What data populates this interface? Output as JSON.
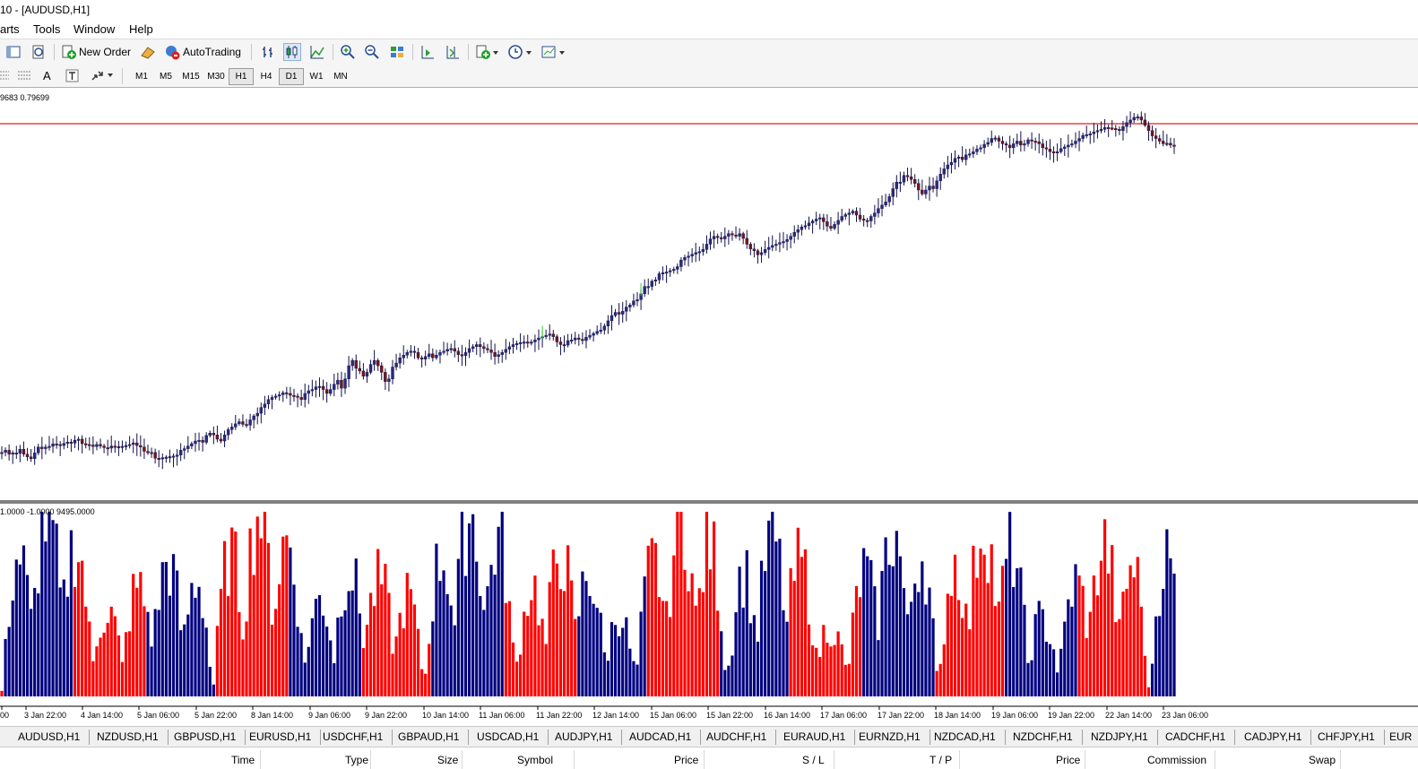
{
  "window": {
    "title": "10 - [AUDUSD,H1]"
  },
  "menu": [
    "arts",
    "Tools",
    "Window",
    "Help"
  ],
  "toolbar": {
    "new_order": "New Order",
    "auto_trading": "AutoTrading",
    "line_tool_label": "A"
  },
  "timeframes": [
    "M1",
    "M5",
    "M15",
    "M30",
    "H1",
    "H4",
    "D1",
    "W1",
    "MN"
  ],
  "active_timeframe": "H1",
  "main_pane": {
    "label": "9683 0.79699",
    "resistance_color": "#e01c1c",
    "up_color": "#2bd12b",
    "down_color": "#7a1414"
  },
  "indicator_pane": {
    "label": "1.0000 -1.0000 9495.0000",
    "bull_color": "#00007f",
    "bear_color": "#ff0000"
  },
  "time_axis": [
    "00",
    "3 Jan 22:00",
    "4 Jan 14:00",
    "5 Jan 06:00",
    "5 Jan 22:00",
    "8 Jan 14:00",
    "9 Jan 06:00",
    "9 Jan 22:00",
    "10 Jan 14:00",
    "11 Jan 06:00",
    "11 Jan 22:00",
    "12 Jan 14:00",
    "15 Jan 06:00",
    "15 Jan 22:00",
    "16 Jan 14:00",
    "17 Jan 06:00",
    "17 Jan 22:00",
    "18 Jan 14:00",
    "19 Jan 06:00",
    "19 Jan 22:00",
    "22 Jan 14:00",
    "23 Jan 06:00"
  ],
  "symbol_tabs": [
    "AUDUSD,H1",
    "NZDUSD,H1",
    "GBPUSD,H1",
    "EURUSD,H1",
    "USDCHF,H1",
    "GBPAUD,H1",
    "USDCAD,H1",
    "AUDJPY,H1",
    "AUDCAD,H1",
    "AUDCHF,H1",
    "EURAUD,H1",
    "EURNZD,H1",
    "NZDCAD,H1",
    "NZDCHF,H1",
    "NZDJPY,H1",
    "CADCHF,H1",
    "CADJPY,H1",
    "CHFJPY,H1",
    "EUR"
  ],
  "terminal_columns": [
    "Time",
    "Type",
    "Size",
    "Symbol",
    "Price",
    "S / L",
    "T / P",
    "Price",
    "Commission",
    "Swap"
  ],
  "chart_data": {
    "type": "candlestick",
    "title": "",
    "price_path": [
      62,
      70,
      55,
      60,
      58,
      74,
      55,
      45,
      38,
      60,
      82,
      76,
      82,
      85,
      94,
      92,
      88,
      96,
      101,
      97,
      108,
      112,
      95,
      92,
      90,
      84,
      92,
      86,
      80,
      78,
      86,
      84,
      83,
      85,
      88,
      92,
      98,
      88,
      82,
      66,
      60,
      62,
      40,
      38,
      42,
      44,
      46,
      48,
      52,
      70,
      76,
      86,
      95,
      105,
      108,
      100,
      126,
      135,
      128,
      112,
      105,
      128,
      148,
      158,
      170,
      178,
      168,
      165,
      185,
      200,
      210,
      232,
      245,
      262,
      270,
      275,
      280,
      288,
      285,
      278,
      275,
      270,
      262,
      285,
      295,
      300,
      310,
      312,
      300,
      285,
      300,
      320,
      335,
      305,
      340,
      390,
      410,
      380,
      370,
      350,
      365,
      395,
      410,
      390,
      365,
      330,
      340,
      385,
      400,
      420,
      430,
      440,
      445,
      440,
      420,
      415,
      425,
      435,
      420,
      430,
      440,
      445,
      452,
      455,
      445,
      432,
      428,
      440,
      455,
      462,
      470,
      462,
      455,
      450,
      440,
      425,
      432,
      440,
      452,
      462,
      470,
      474,
      478,
      480,
      478,
      480,
      488,
      495,
      500,
      505,
      510,
      500,
      480,
      470,
      468,
      485,
      488,
      495,
      490,
      485,
      498,
      505,
      512,
      520,
      525,
      540,
      560,
      580,
      592,
      585,
      596,
      612,
      620,
      635,
      640,
      662,
      690,
      690,
      710,
      715,
      738,
      742,
      745,
      750,
      755,
      765,
      790,
      800,
      805,
      812,
      818,
      822,
      830,
      850,
      870,
      880,
      875,
      870,
      880,
      890,
      885,
      880,
      890,
      872,
      850,
      832,
      825,
      810,
      818,
      830,
      838,
      845,
      850,
      856,
      860,
      868,
      880,
      895,
      905,
      915,
      920,
      930,
      938,
      945,
      950,
      935,
      918,
      910,
      925,
      940,
      955,
      962,
      968,
      975,
      960,
      945,
      940,
      938,
      955,
      968,
      985,
      998,
      1010,
      1030,
      1060,
      1085,
      1085,
      1110,
      1105,
      1095,
      1080,
      1055,
      1040,
      1055,
      1070,
      1060,
      1090,
      1115,
      1135,
      1150,
      1160,
      1175,
      1180,
      1170,
      1188,
      1192,
      1200,
      1210,
      1215,
      1228,
      1235,
      1250,
      1252,
      1240,
      1230,
      1225,
      1215,
      1230,
      1240,
      1225,
      1230,
      1245,
      1240,
      1238,
      1230,
      1215,
      1210,
      1200,
      1195,
      1200,
      1212,
      1218,
      1225,
      1230,
      1240,
      1250,
      1262,
      1265,
      1268,
      1275,
      1280,
      1285,
      1292,
      1290,
      1288,
      1285,
      1280,
      1295,
      1310,
      1320,
      1330,
      1332,
      1320,
      1300,
      1280,
      1260,
      1250,
      1240,
      1230,
      1232,
      1225,
      1220
    ]
  }
}
